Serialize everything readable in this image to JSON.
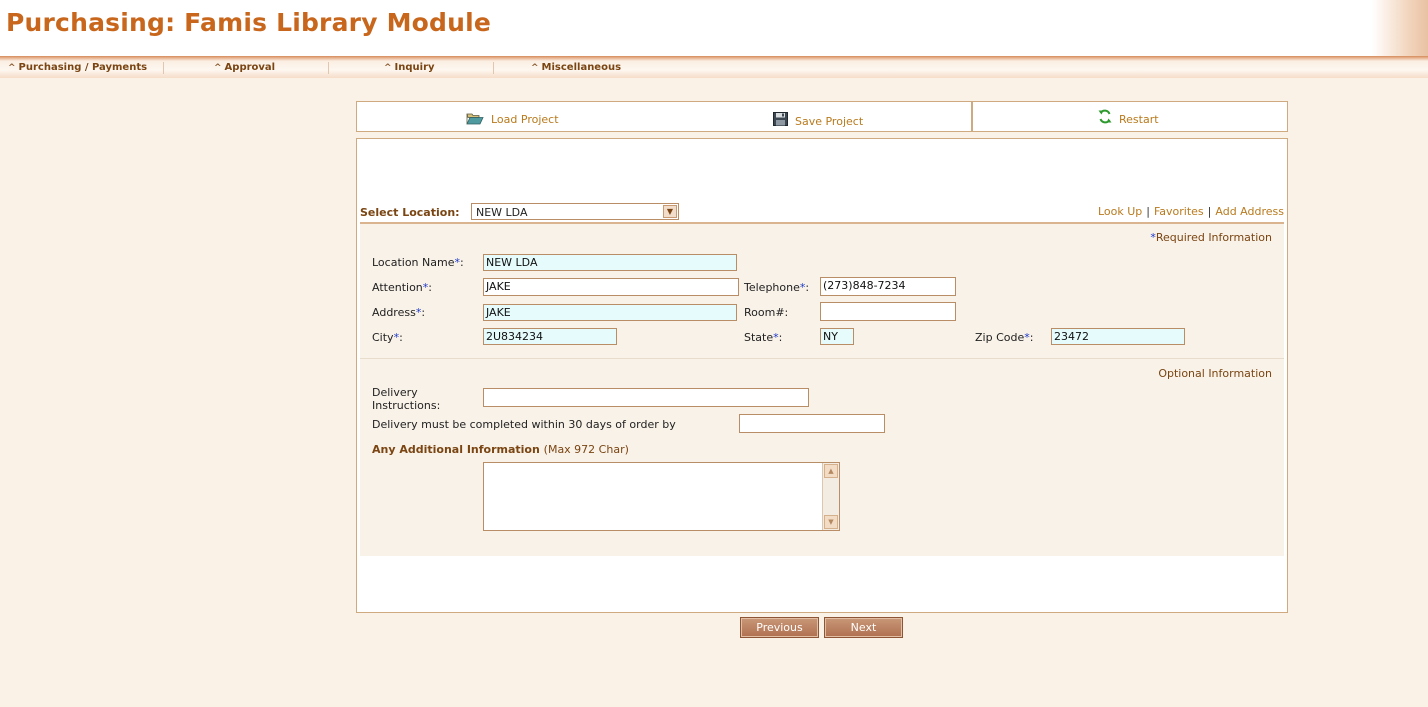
{
  "app": {
    "title": "Purchasing: Famis Library Module"
  },
  "nav": {
    "items": [
      {
        "label": "Purchasing / Payments"
      },
      {
        "label": "Approval"
      },
      {
        "label": "Inquiry"
      },
      {
        "label": "Miscellaneous"
      }
    ]
  },
  "toolbar": {
    "load_label": "Load Project",
    "save_label": "Save Project",
    "restart_label": "Restart"
  },
  "location": {
    "label": "Select Location:",
    "selected": "NEW LDA",
    "links": {
      "lookup": "Look Up",
      "favorites": "Favorites",
      "add_address": "Add Address"
    }
  },
  "required_note": {
    "star": "*",
    "text": "Required Information"
  },
  "optional_note": "Optional Information",
  "fields": {
    "location_name": {
      "label": "Location Name",
      "star": "*",
      "suffix": ":",
      "value": "NEW LDA"
    },
    "attention": {
      "label": "Attention",
      "star": "*",
      "suffix": ":",
      "value": "JAKE"
    },
    "telephone": {
      "label": "Telephone",
      "star": "*",
      "suffix": ":",
      "value": "(273)848-7234"
    },
    "address": {
      "label": "Address",
      "star": "*",
      "suffix": ":",
      "value": "JAKE"
    },
    "room": {
      "label": "Room#:",
      "value": ""
    },
    "city": {
      "label": "City",
      "star": "*",
      "suffix": ":",
      "value": "2U834234"
    },
    "state": {
      "label": "State",
      "star": "*",
      "suffix": ":",
      "value": "NY"
    },
    "zip": {
      "label": "Zip Code",
      "star": "*",
      "suffix": ":",
      "value": "23472"
    },
    "delivery_instructions": {
      "label_line1": "Delivery",
      "label_line2": "Instructions:",
      "value": ""
    },
    "delivery_by": {
      "label": "Delivery must be completed within 30 days of order by",
      "value": ""
    }
  },
  "additional": {
    "title": "Any Additional Information",
    "note": "(Max 972 Char)",
    "value": ""
  },
  "buttons": {
    "previous": "Previous",
    "next": "Next"
  },
  "colors": {
    "brand": "#c8661c",
    "link": "#b97a1d",
    "required_star": "#1e3ac8",
    "input_bg": "#e6fcfc"
  }
}
